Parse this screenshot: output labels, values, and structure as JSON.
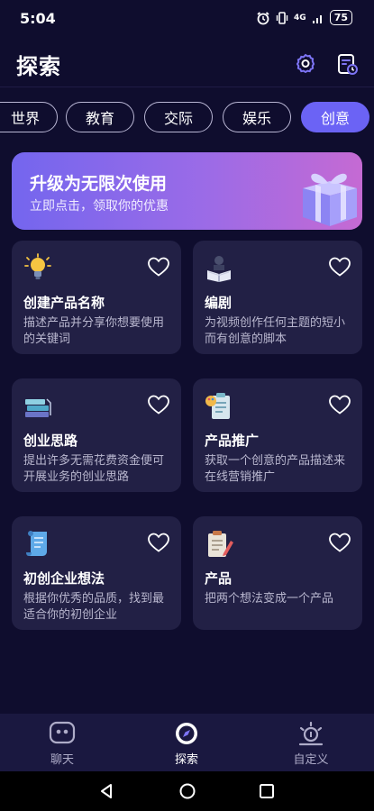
{
  "status": {
    "time": "5:04",
    "network": "4G",
    "battery": "75"
  },
  "header": {
    "title": "探索"
  },
  "tabs": [
    {
      "label": "世界"
    },
    {
      "label": "教育"
    },
    {
      "label": "交际"
    },
    {
      "label": "娱乐"
    },
    {
      "label": "创意",
      "active": true
    }
  ],
  "banner": {
    "title": "升级为无限次使用",
    "subtitle": "立即点击，领取你的优惠"
  },
  "cards": [
    {
      "title": "创建产品名称",
      "desc": "描述产品并分享你想要使用的关键词",
      "icon": "lightbulb-icon"
    },
    {
      "title": "编剧",
      "desc": "为视频创作任何主题的短小而有创意的脚本",
      "icon": "book-reader-icon"
    },
    {
      "title": "创业思路",
      "desc": "提出许多无需花费资金便可开展业务的创业思路",
      "icon": "stacked-books-icon"
    },
    {
      "title": "产品推广",
      "desc": "获取一个创意的产品描述来在线营销推广",
      "icon": "clipboard-palette-icon"
    },
    {
      "title": "初创企业想法",
      "desc": "根据你优秀的品质，找到最适合你的初创企业",
      "icon": "scroll-icon"
    },
    {
      "title": "产品",
      "desc": "把两个想法变成一个产品",
      "icon": "clipboard-pencil-icon"
    }
  ],
  "nav": [
    {
      "label": "聊天",
      "icon": "chat-bot-icon"
    },
    {
      "label": "探索",
      "icon": "compass-icon",
      "active": true
    },
    {
      "label": "自定义",
      "icon": "bulb-custom-icon"
    }
  ],
  "colors": {
    "background": "#0f0d2e",
    "card": "#222045",
    "accent": "#6b63f5"
  }
}
